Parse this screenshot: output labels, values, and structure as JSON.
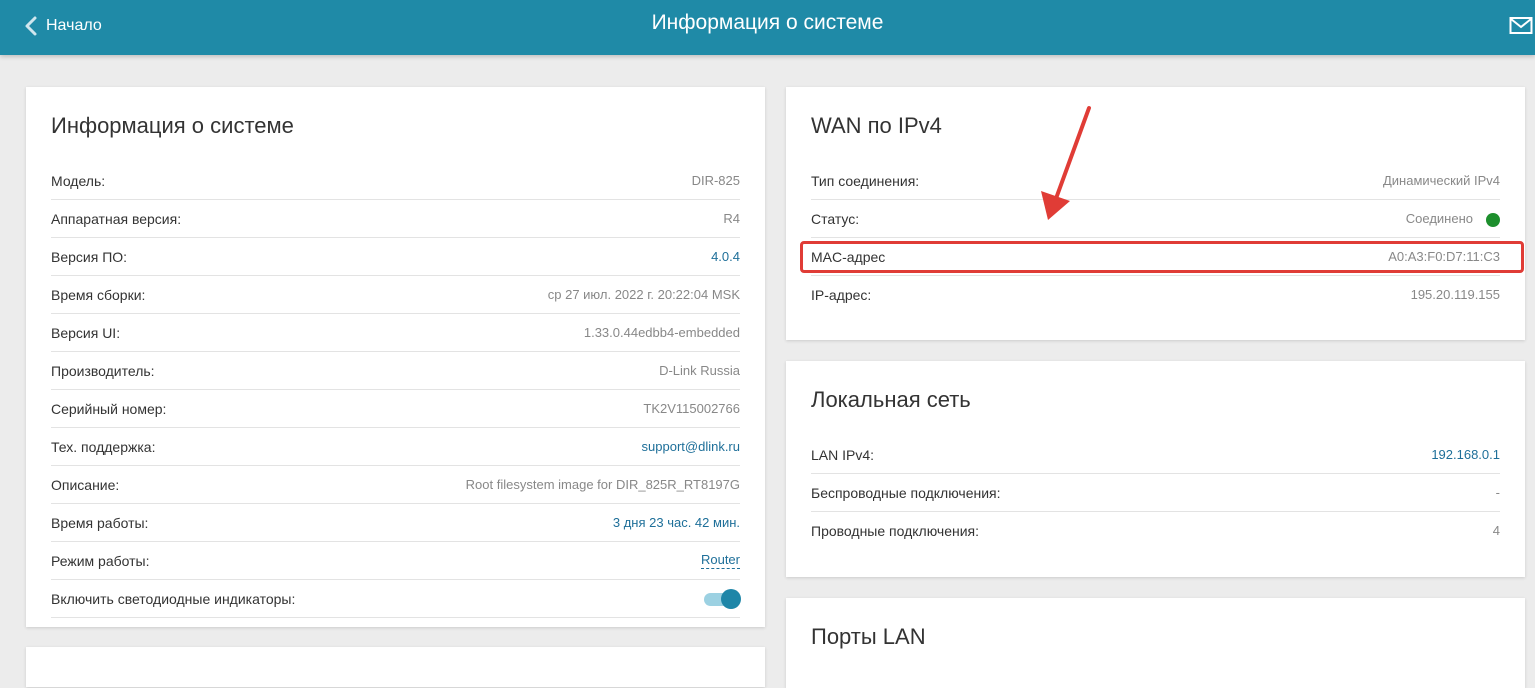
{
  "header": {
    "back_label": "Начало",
    "title": "Информация о системе"
  },
  "system_info": {
    "title": "Информация о системе",
    "rows": [
      {
        "label": "Модель:",
        "value": "DIR-825"
      },
      {
        "label": "Аппаратная версия:",
        "value": "R4"
      },
      {
        "label": "Версия ПО:",
        "value": "4.0.4"
      },
      {
        "label": "Время сборки:",
        "value": "ср 27 июл. 2022 г. 20:22:04 MSK"
      },
      {
        "label": "Версия UI:",
        "value": "1.33.0.44edbb4-embedded"
      },
      {
        "label": "Производитель:",
        "value": "D-Link Russia"
      },
      {
        "label": "Серийный номер:",
        "value": "TK2V115002766"
      },
      {
        "label": "Тех. поддержка:",
        "value": "support@dlink.ru"
      },
      {
        "label": "Описание:",
        "value": "Root filesystem image for DIR_825R_RT8197G"
      },
      {
        "label": "Время работы:",
        "value": "3 дня 23 час. 42 мин."
      },
      {
        "label": "Режим работы:",
        "value": "Router"
      },
      {
        "label": "Включить светодиодные индикаторы:",
        "value": "on"
      }
    ]
  },
  "wan": {
    "title": "WAN по IPv4",
    "rows": [
      {
        "label": "Тип соединения:",
        "value": "Динамический IPv4"
      },
      {
        "label": "Статус:",
        "value": "Соединено"
      },
      {
        "label": "MAC-адрес",
        "value": "A0:A3:F0:D7:11:C3"
      },
      {
        "label": "IP-адрес:",
        "value": "195.20.119.155"
      }
    ]
  },
  "lan": {
    "title": "Локальная сеть",
    "rows": [
      {
        "label": "LAN IPv4:",
        "value": "192.168.0.1"
      },
      {
        "label": "Беспроводные подключения:",
        "value": "-"
      },
      {
        "label": "Проводные подключения:",
        "value": "4"
      }
    ]
  },
  "lan_ports": {
    "title": "Порты LAN"
  },
  "colors": {
    "header": "#1f8aa7",
    "link": "#1e6f99",
    "status_ok": "#1d8f2d",
    "annotation": "#e03c36"
  }
}
